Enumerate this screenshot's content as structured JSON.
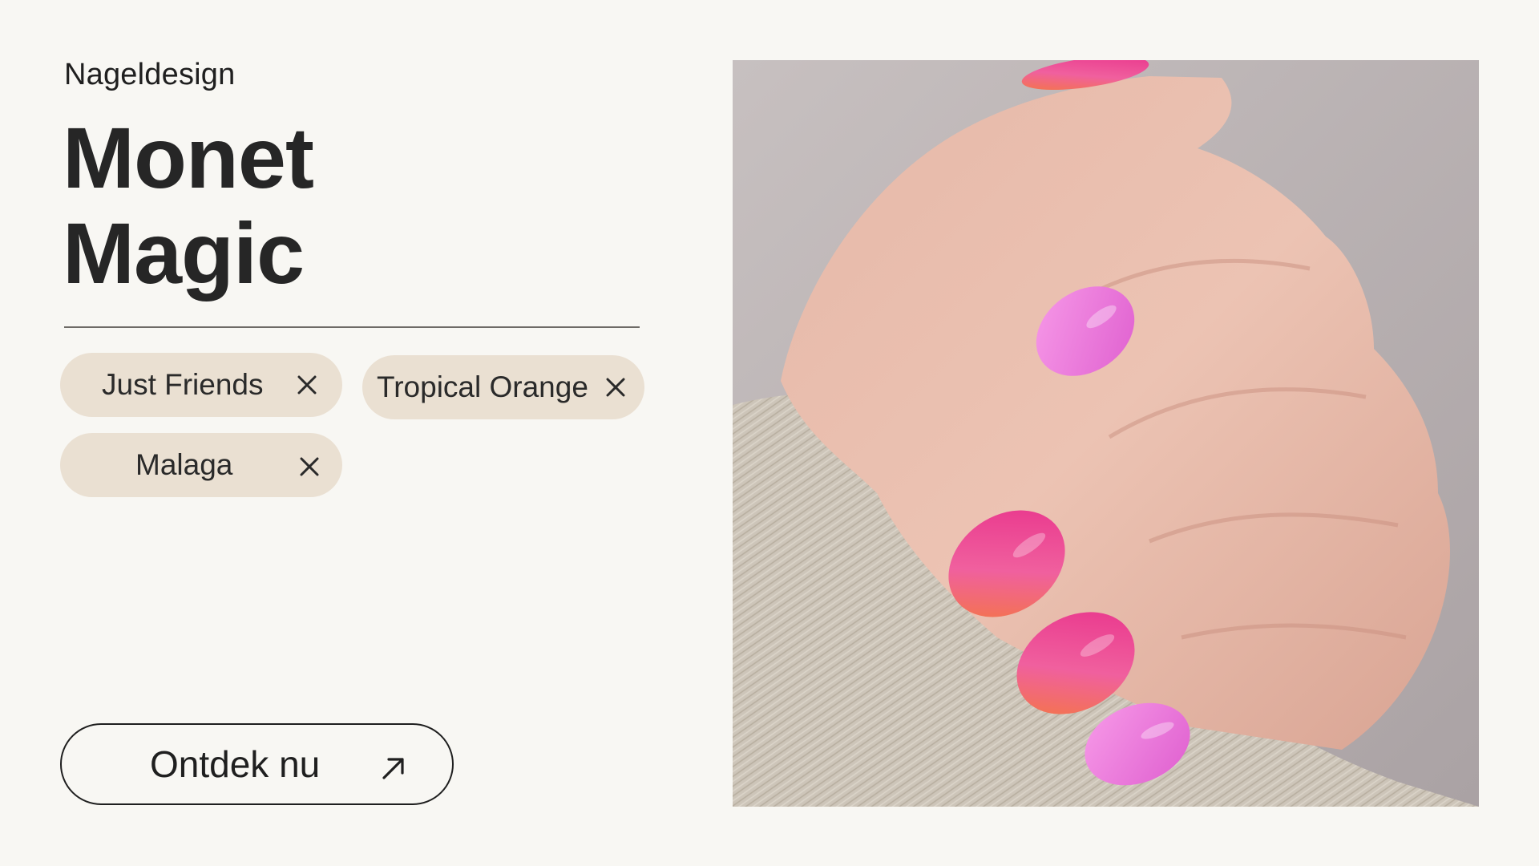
{
  "header": {
    "eyebrow": "Nageldesign",
    "title_line1": "Monet",
    "title_line2": "Magic"
  },
  "filters": [
    {
      "label": "Just Friends",
      "icon": "close-icon"
    },
    {
      "label": "Tropical Orange",
      "icon": "close-icon"
    },
    {
      "label": "Malaga",
      "icon": "close-icon"
    }
  ],
  "cta": {
    "label": "Ontdek nu",
    "icon": "arrow-up-right-icon"
  },
  "colors": {
    "background": "#f8f7f3",
    "chip_background": "#eae0d2",
    "text": "#1f1f1f",
    "nail_pink": "#e56fd6",
    "nail_magenta": "#e8308a",
    "nail_orange": "#f57a35"
  }
}
